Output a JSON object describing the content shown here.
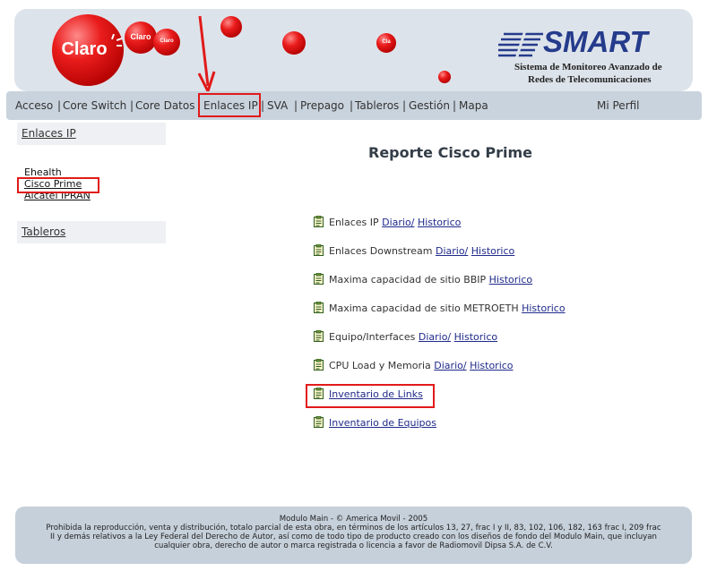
{
  "header": {
    "claro_logo_text": "Claro",
    "small_ball_1": "Claro",
    "small_ball_2": "Claro",
    "small_ball_3": "Cla",
    "brand": "SMART",
    "subtitle_line1": "Sistema de Monitoreo Avanzado de",
    "subtitle_line2": "Redes de Telecomunicaciones"
  },
  "nav": {
    "items": [
      "Acceso",
      "Core Switch",
      "Core Datos",
      "Enlaces IP",
      "SVA",
      "Prepago",
      "Tableros",
      "Gestión",
      "Mapa"
    ],
    "profile": "Mi Perfil"
  },
  "sidebar": {
    "section1": "Enlaces IP",
    "links": [
      "Ehealth",
      "Cisco Prime",
      "Alcatel IPRAN"
    ],
    "section2": "Tableros"
  },
  "main": {
    "title": "Reporte Cisco Prime",
    "reports": [
      {
        "label": "Enlaces IP",
        "links": [
          "Diario/",
          "Historico"
        ]
      },
      {
        "label": "Enlaces Downstream",
        "links": [
          "Diario/",
          "Historico"
        ]
      },
      {
        "label": "Maxima capacidad de sitio BBIP",
        "links": [
          "Historico"
        ]
      },
      {
        "label": "Maxima capacidad de sitio METROETH",
        "links": [
          "Historico"
        ]
      },
      {
        "label": "Equipo/Interfaces",
        "links": [
          "Diario/",
          "Historico"
        ]
      },
      {
        "label": "CPU Load y Memoria",
        "links": [
          "Diario/",
          "Historico"
        ]
      },
      {
        "label": "",
        "links": [
          "Inventario de Links"
        ]
      },
      {
        "label": "",
        "links": [
          "Inventario de Equipos"
        ]
      }
    ]
  },
  "footer": {
    "line1": "Modulo Main - © America Movil - 2005",
    "line2": "Prohibida la reproducción, venta y distribución, totalo parcial de esta obra, en términos de los artículos 13, 27, frac I y II, 83, 102, 106, 182, 163 frac I, 209 frac",
    "line3": "II y demás relativos a la Ley Federal del Derecho de Autor, así como de todo tipo de producto creado con los diseños de fondo del Modulo Main, que incluyan",
    "line4": "cualquier obra, derecho de autor o marca registrada o licencia a favor de Radiomovil Dipsa S.A. de C.V."
  },
  "colors": {
    "accent_red": "#e11a1a",
    "brand_blue": "#253b8c",
    "nav_bg": "#c9d3dd",
    "link_blue": "#1f2a8a"
  },
  "icons": {
    "report": "clipboard-icon",
    "annotation": "red-arrow-icon"
  }
}
